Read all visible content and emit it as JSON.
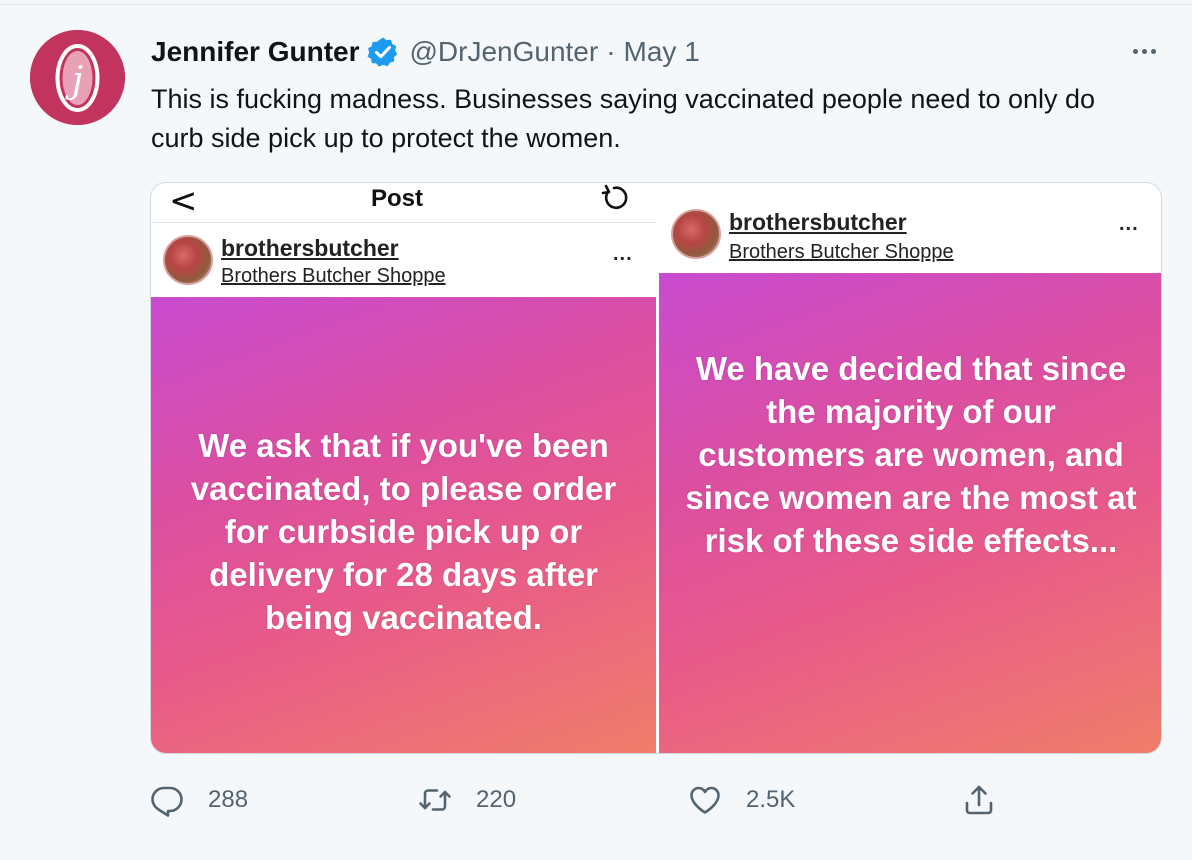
{
  "tweet": {
    "author_name": "Jennifer Gunter",
    "handle": "@DrJenGunter",
    "separator": "·",
    "date": "May 1",
    "text": "This is fucking madness. Businesses saying vaccinated people need to only do curb side pick up to protect the women.",
    "avatar_letter": "j",
    "verified_icon": "verified-badge-icon",
    "more_icon": "more-dots-icon"
  },
  "media": {
    "left_panel": {
      "topbar_back": "<",
      "topbar_title": "Post",
      "username": "brothersbutcher",
      "location": "Brothers Butcher Shoppe",
      "more": "...",
      "story_text": "We ask that if you've been vaccinated, to please order for curbside pick up or delivery for 28 days after being vaccinated."
    },
    "right_panel": {
      "username": "brothersbutcher",
      "location": "Brothers Butcher Shoppe",
      "more": "...",
      "story_text": "We have decided that since the majority of our customers are women, and since women are the most at risk of these side effects..."
    }
  },
  "actions": {
    "reply_count": "288",
    "retweet_count": "220",
    "like_count": "2.5K"
  },
  "colors": {
    "avatar_bg": "#c2335e",
    "verified": "#1d9bf0",
    "secondary_text": "#536471",
    "story_gradient_start": "#c94bd0",
    "story_gradient_end": "#f07e6a"
  }
}
